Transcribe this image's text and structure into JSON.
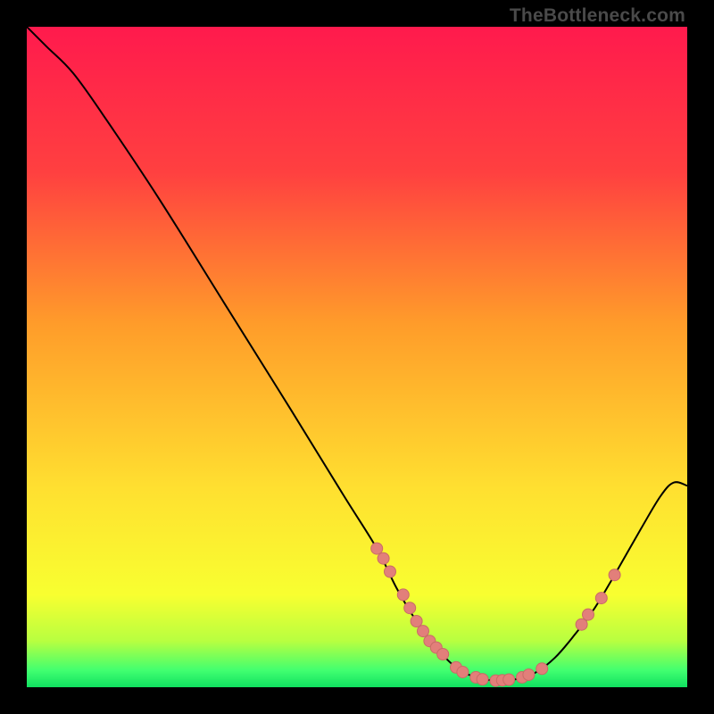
{
  "attribution": "TheBottleneck.com",
  "colors": {
    "gradient_stops": [
      {
        "offset": 0.0,
        "color": "#ff1a4d"
      },
      {
        "offset": 0.22,
        "color": "#ff4040"
      },
      {
        "offset": 0.45,
        "color": "#ff9c2a"
      },
      {
        "offset": 0.7,
        "color": "#ffe030"
      },
      {
        "offset": 0.86,
        "color": "#f8ff30"
      },
      {
        "offset": 0.93,
        "color": "#b8ff40"
      },
      {
        "offset": 0.975,
        "color": "#40ff70"
      },
      {
        "offset": 1.0,
        "color": "#10e060"
      }
    ],
    "curve_stroke": "#000000",
    "marker_fill": "#e27f7a",
    "marker_stroke": "#c96b66"
  },
  "chart_data": {
    "type": "line",
    "title": "",
    "xlabel": "",
    "ylabel": "",
    "xlim": [
      0,
      100
    ],
    "ylim": [
      0,
      100
    ],
    "curve": [
      {
        "x": 0,
        "y": 100
      },
      {
        "x": 3,
        "y": 97
      },
      {
        "x": 7,
        "y": 93
      },
      {
        "x": 12,
        "y": 86
      },
      {
        "x": 20,
        "y": 74
      },
      {
        "x": 30,
        "y": 58
      },
      {
        "x": 40,
        "y": 42
      },
      {
        "x": 48,
        "y": 29
      },
      {
        "x": 53,
        "y": 21
      },
      {
        "x": 56,
        "y": 15
      },
      {
        "x": 59,
        "y": 10
      },
      {
        "x": 62,
        "y": 6
      },
      {
        "x": 65,
        "y": 3
      },
      {
        "x": 68,
        "y": 1.5
      },
      {
        "x": 71,
        "y": 1
      },
      {
        "x": 74,
        "y": 1.2
      },
      {
        "x": 77,
        "y": 2.2
      },
      {
        "x": 80,
        "y": 4.5
      },
      {
        "x": 83,
        "y": 8
      },
      {
        "x": 86,
        "y": 12
      },
      {
        "x": 89,
        "y": 17
      },
      {
        "x": 93,
        "y": 24
      },
      {
        "x": 96,
        "y": 29
      },
      {
        "x": 98,
        "y": 31
      },
      {
        "x": 100,
        "y": 30.5
      }
    ],
    "markers": [
      {
        "x": 53,
        "y": 21
      },
      {
        "x": 54,
        "y": 19.5
      },
      {
        "x": 55,
        "y": 17.5
      },
      {
        "x": 57,
        "y": 14
      },
      {
        "x": 58,
        "y": 12
      },
      {
        "x": 59,
        "y": 10
      },
      {
        "x": 60,
        "y": 8.5
      },
      {
        "x": 61,
        "y": 7
      },
      {
        "x": 62,
        "y": 6
      },
      {
        "x": 63,
        "y": 5
      },
      {
        "x": 65,
        "y": 3
      },
      {
        "x": 66,
        "y": 2.3
      },
      {
        "x": 68,
        "y": 1.5
      },
      {
        "x": 69,
        "y": 1.2
      },
      {
        "x": 71,
        "y": 1
      },
      {
        "x": 72,
        "y": 1.05
      },
      {
        "x": 73,
        "y": 1.15
      },
      {
        "x": 75,
        "y": 1.5
      },
      {
        "x": 76,
        "y": 1.9
      },
      {
        "x": 78,
        "y": 2.8
      },
      {
        "x": 84,
        "y": 9.5
      },
      {
        "x": 85,
        "y": 11
      },
      {
        "x": 87,
        "y": 13.5
      },
      {
        "x": 89,
        "y": 17
      }
    ]
  }
}
